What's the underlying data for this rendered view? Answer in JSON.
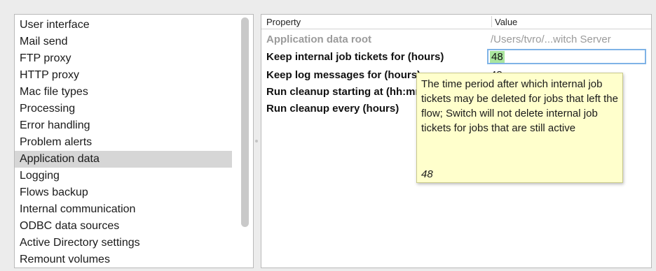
{
  "categories": [
    {
      "label": "User interface"
    },
    {
      "label": "Mail send"
    },
    {
      "label": "FTP proxy"
    },
    {
      "label": "HTTP proxy"
    },
    {
      "label": "Mac file types"
    },
    {
      "label": "Processing"
    },
    {
      "label": "Error handling"
    },
    {
      "label": "Problem alerts"
    },
    {
      "label": "Application data",
      "selected": true
    },
    {
      "label": "Logging"
    },
    {
      "label": "Flows backup"
    },
    {
      "label": "Internal communication"
    },
    {
      "label": "ODBC data sources"
    },
    {
      "label": "Active Directory settings"
    },
    {
      "label": "Remount volumes"
    }
  ],
  "table": {
    "header_property": "Property",
    "header_value": "Value",
    "rows": [
      {
        "name": "Application data root",
        "value": "/Users/tvro/...witch Server",
        "disabled": true
      },
      {
        "name": "Keep internal job tickets for (hours)",
        "value": "48",
        "editing": true
      },
      {
        "name": "Keep log messages for (hours)",
        "value": "48"
      },
      {
        "name": "Run cleanup starting at (hh:mm)",
        "value": ""
      },
      {
        "name": "Run cleanup every (hours)",
        "value": ""
      }
    ]
  },
  "tooltip": {
    "text": "The time period after which internal job tickets may be deleted for jobs that left the flow; Switch will not delete internal job tickets for jobs that are still active",
    "value": "48"
  },
  "colors": {
    "selection": "#d6d6d6",
    "tooltip_bg": "#ffffcc",
    "edit_highlight": "#a9e59e",
    "focus_ring": "#7fb3e6"
  }
}
